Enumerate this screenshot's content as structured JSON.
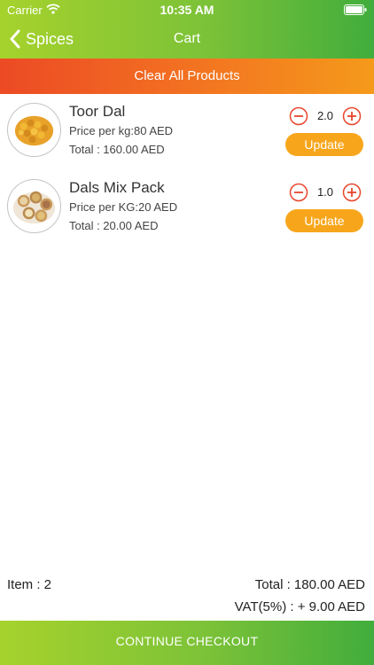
{
  "status_bar": {
    "carrier": "Carrier",
    "time": "10:35 AM"
  },
  "nav": {
    "back_label": "Spices",
    "title": "Cart"
  },
  "clear_all_label": "Clear All Products",
  "cart_items": [
    {
      "name": "Toor Dal",
      "price": "Price per kg:80 AED",
      "total": "Total : 160.00 AED",
      "quantity": "2.0",
      "update_label": "Update",
      "image_icon": "toor-dal-image"
    },
    {
      "name": "Dals Mix Pack",
      "price": "Price per KG:20 AED",
      "total": "Total : 20.00 AED",
      "quantity": "1.0",
      "update_label": "Update",
      "image_icon": "dals-mix-image"
    }
  ],
  "summary": {
    "item_count": "Item : 2",
    "total": "Total : 180.00 AED",
    "vat": "VAT(5%) : + 9.00 AED"
  },
  "checkout_label": "CONTINUE CHECKOUT",
  "colors": {
    "green_start": "#a6d22c",
    "green_end": "#41ad3c",
    "orange_start": "#ec4a24",
    "orange_end": "#f59a1b",
    "update_button": "#f7a61c",
    "stepper_red": "#e8452c"
  }
}
